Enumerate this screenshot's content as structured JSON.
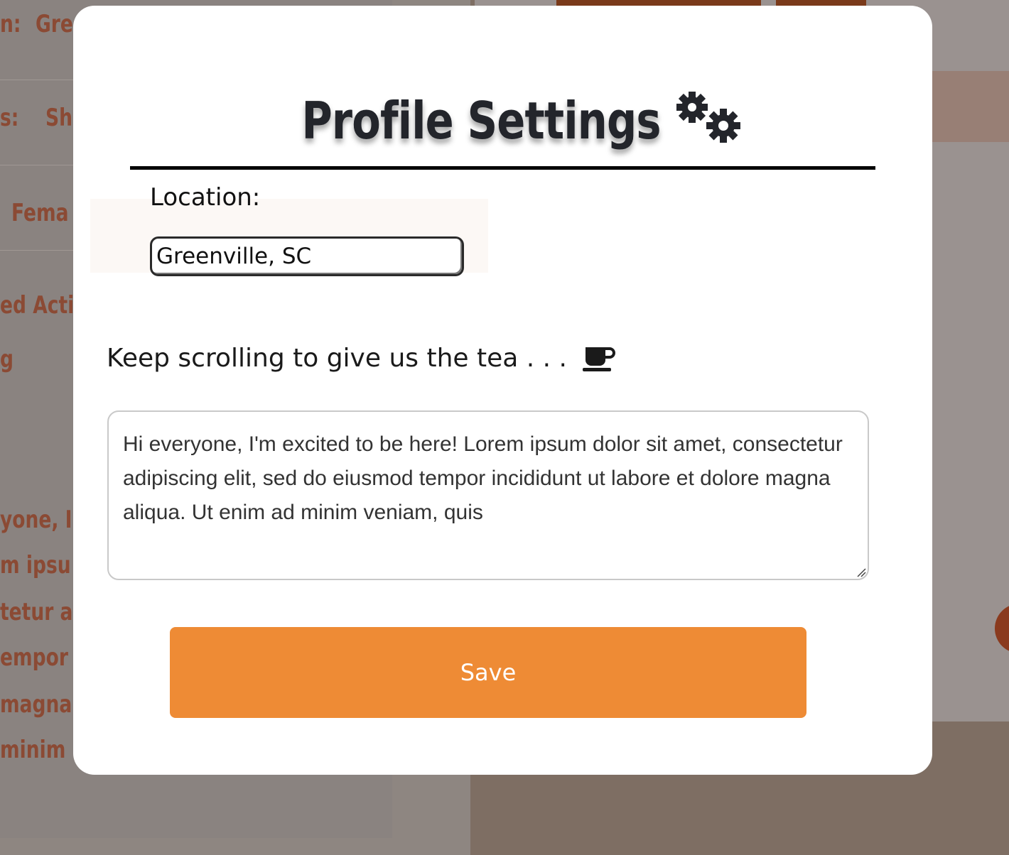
{
  "background": {
    "left_fragments": [
      "n:",
      "Gre",
      "s:",
      "Sh",
      "Fema",
      "ed Acti",
      "g",
      "yone, I",
      "m ipsu",
      "tetur a",
      "empor",
      " magna",
      "minim"
    ]
  },
  "modal": {
    "title": "Profile Settings",
    "title_icon": "gears-icon",
    "location": {
      "label": "Location:",
      "value": "Greenville, SC"
    },
    "tea_prompt": "Keep scrolling to give us the tea . . .",
    "tea_icon": "mug-icon",
    "bio": {
      "value": "Hi everyone, I'm excited to be here! Lorem ipsum dolor sit amet, consectetur adipiscing elit, sed do eiusmod tempor incididunt ut labore et dolore magna aliqua. Ut enim ad minim veniam, quis"
    },
    "save_label": "Save"
  },
  "colors": {
    "accent": "#ee8b35",
    "title": "#23252b",
    "overlay": "#8d847f"
  }
}
